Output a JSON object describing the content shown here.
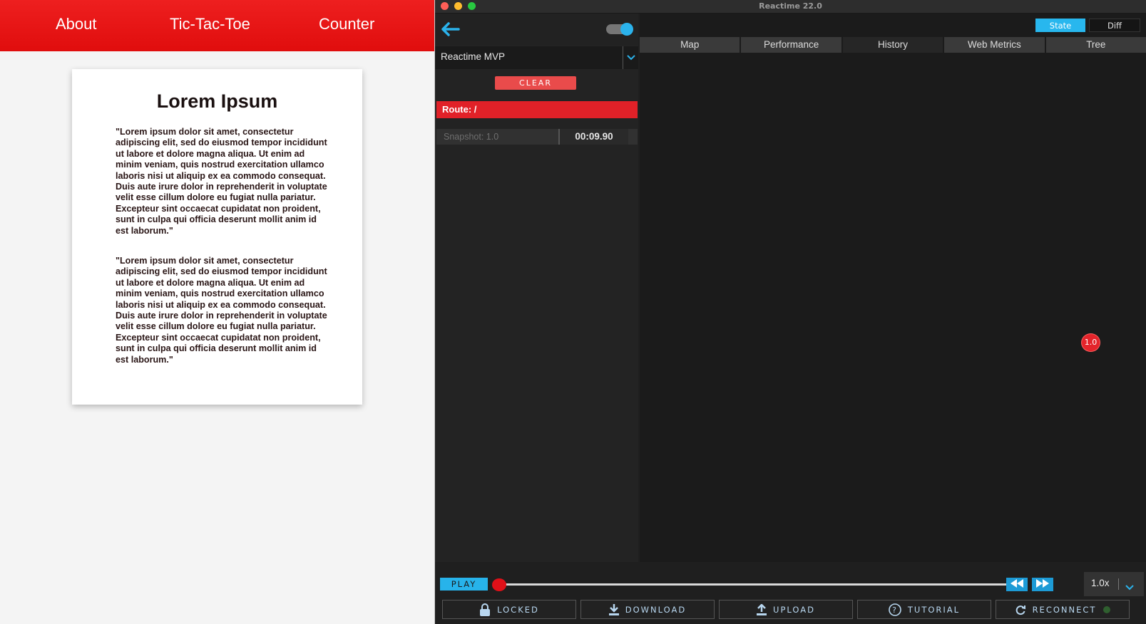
{
  "app": {
    "nav": [
      "About",
      "Tic-Tac-Toe",
      "Counter"
    ],
    "article_title": "Lorem Ipsum",
    "paragraphs": [
      "\"Lorem ipsum dolor sit amet, consectetur adipiscing elit, sed do eiusmod tempor incididunt ut labore et dolore magna aliqua. Ut enim ad minim veniam, quis nostrud exercitation ullamco laboris nisi ut aliquip ex ea commodo consequat. Duis aute irure dolor in reprehenderit in voluptate velit esse cillum dolore eu fugiat nulla pariatur. Excepteur sint occaecat cupidatat non proident, sunt in culpa qui officia deserunt mollit anim id est laborum.\"",
      "\"Lorem ipsum dolor sit amet, consectetur adipiscing elit, sed do eiusmod tempor incididunt ut labore et dolore magna aliqua. Ut enim ad minim veniam, quis nostrud exercitation ullamco laboris nisi ut aliquip ex ea commodo consequat. Duis aute irure dolor in reprehenderit in voluptate velit esse cillum dolore eu fugiat nulla pariatur. Excepteur sint occaecat cupidatat non proident, sunt in culpa qui officia deserunt mollit anim id est laborum.\""
    ],
    "colors": {
      "nav_bg": "#e8161b",
      "page_bg": "#f4f4f4"
    }
  },
  "devtool": {
    "window_title": "Reactime 22.0",
    "app_select": "Reactime MVP",
    "clear_label": "CLEAR",
    "route_label": "Route: /",
    "snapshot": {
      "label": "Snapshot: 1.0",
      "time": "00:09.90"
    },
    "view_buttons": {
      "state": "State",
      "diff": "Diff"
    },
    "tabs": [
      "Map",
      "Performance",
      "History",
      "Web Metrics",
      "Tree"
    ],
    "active_tab": "History",
    "history_node": "1.0",
    "play_label": "PLAY",
    "speed": "1.0x",
    "bottom_buttons": {
      "locked": "LOCKED",
      "download": "DOWNLOAD",
      "upload": "UPLOAD",
      "tutorial": "TUTORIAL",
      "reconnect": "RECONNECT"
    },
    "icons": {
      "back": "arrow-left-icon",
      "dropdown": "chevron-down-icon",
      "rewind": "rewind-icon",
      "fast_forward": "fast-forward-icon",
      "locked": "lock-icon",
      "download": "download-icon",
      "upload": "upload-icon",
      "tutorial": "question-circle-icon",
      "reconnect": "refresh-icon"
    },
    "colors": {
      "accent_blue": "#28b7ee",
      "accent_red": "#e12128",
      "window_bg": "#1f1f1f"
    }
  }
}
